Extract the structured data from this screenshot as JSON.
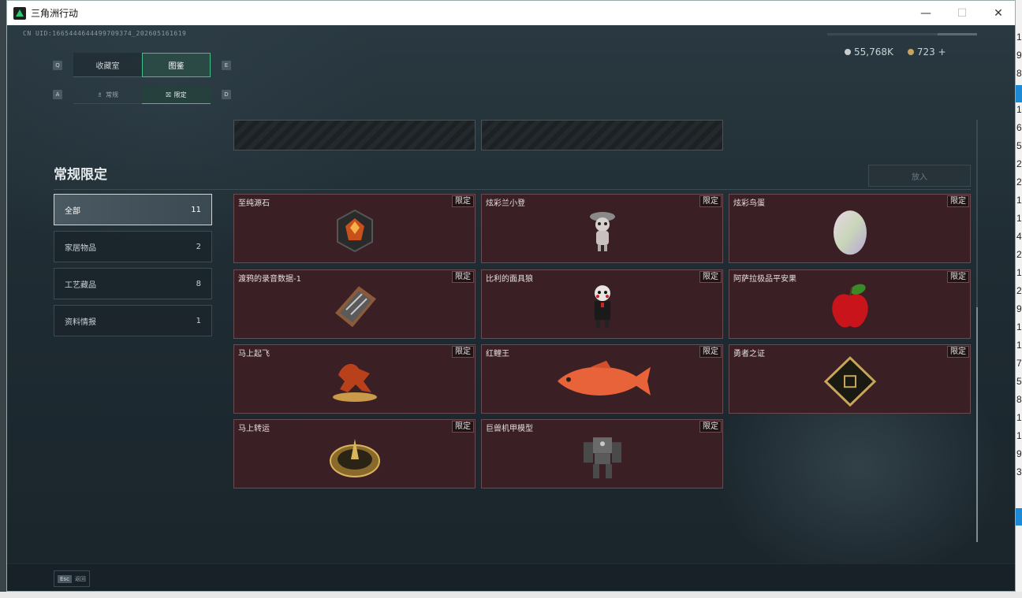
{
  "window": {
    "title": "三角洲行动",
    "minimize": "—",
    "maximize": "☐",
    "close": "✕"
  },
  "uid": "CN UID:1665444644499709374_202605161619",
  "currency": [
    {
      "icon": "silver-coin-icon",
      "value": "55,768K"
    },
    {
      "icon": "gold-coin-icon",
      "value": "723 +"
    }
  ],
  "tabs": {
    "left_key": "Q",
    "right_key": "E",
    "items": [
      {
        "label": "收藏室",
        "active": false
      },
      {
        "label": "图鉴",
        "active": true
      }
    ]
  },
  "subtabs": {
    "left_key": "A",
    "right_key": "D",
    "items": [
      {
        "label": "常规",
        "icon": "♗",
        "active": false
      },
      {
        "label": "限定",
        "icon": "⛝",
        "active": true
      }
    ]
  },
  "section": {
    "title": "常规限定",
    "put_label": "放入"
  },
  "categories": [
    {
      "label": "全部",
      "count": "11",
      "active": true
    },
    {
      "label": "家居物品",
      "count": "2",
      "active": false
    },
    {
      "label": "工艺藏品",
      "count": "8",
      "active": false
    },
    {
      "label": "资料情报",
      "count": "1",
      "active": false
    }
  ],
  "items": [
    {
      "name": "至纯源石",
      "tag": "限定",
      "icon": "gem-icon"
    },
    {
      "name": "炫彩兰小登",
      "tag": "限定",
      "icon": "figurine-icon"
    },
    {
      "name": "炫彩鸟蛋",
      "tag": "限定",
      "icon": "egg-icon"
    },
    {
      "name": "渡鸦的录音数据-1",
      "tag": "限定",
      "icon": "recorder-icon"
    },
    {
      "name": "比利的面具狼",
      "tag": "限定",
      "icon": "puppet-icon"
    },
    {
      "name": "阿萨拉极品平安果",
      "tag": "限定",
      "icon": "apple-icon"
    },
    {
      "name": "马上起飞",
      "tag": "限定",
      "icon": "horse-icon"
    },
    {
      "name": "红鲤王",
      "tag": "限定",
      "icon": "carp-icon"
    },
    {
      "name": "勇者之证",
      "tag": "限定",
      "icon": "card-icon"
    },
    {
      "name": "马上转运",
      "tag": "限定",
      "icon": "compass-icon"
    },
    {
      "name": "巨兽机甲模型",
      "tag": "限定",
      "icon": "mech-icon"
    }
  ],
  "footer": {
    "key": "Esc",
    "label": "返回"
  },
  "desktop_numbers": [
    "1",
    "9",
    "8",
    "",
    "1",
    "6",
    "5",
    "2",
    "2",
    "1",
    "1",
    "4",
    "2",
    "1",
    "2",
    "9",
    "1",
    "1",
    "7",
    "5",
    "8",
    "1",
    "1",
    "9",
    "3"
  ],
  "colors": {
    "accent": "#3fbf8a",
    "card_bg": "#3a1f24",
    "card_border": "#6b4a50"
  }
}
